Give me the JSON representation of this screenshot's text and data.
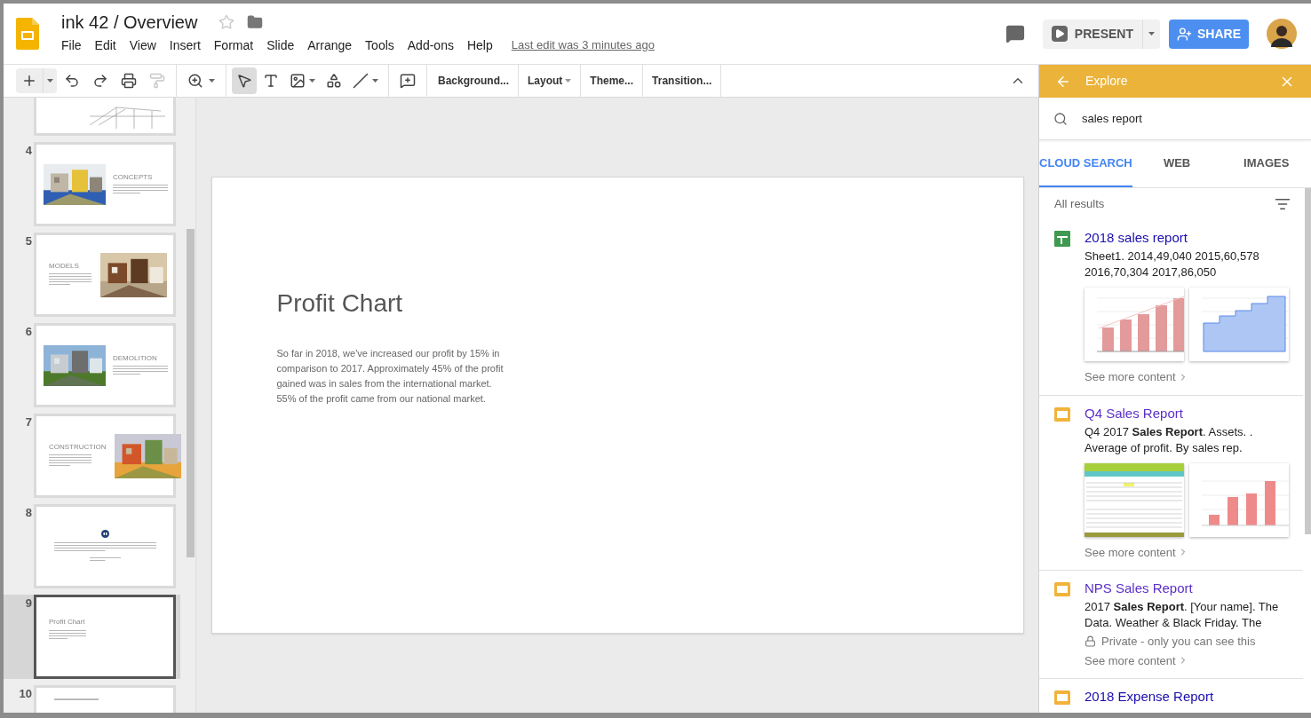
{
  "document": {
    "title": "ink 42 / Overview",
    "starred": false
  },
  "menu": [
    "File",
    "Edit",
    "View",
    "Insert",
    "Format",
    "Slide",
    "Arrange",
    "Tools",
    "Add-ons",
    "Help"
  ],
  "last_edit": "Last edit was 3 minutes ago",
  "present": "PRESENT",
  "share": "SHARE",
  "toolbar": {
    "paint_format_disabled": true,
    "tools": [
      {
        "selected": true
      },
      {
        "selected": false
      },
      {
        "selected": false
      },
      {
        "selected": false
      },
      {
        "selected": false
      }
    ],
    "text_buttons": [
      {
        "label": "Background...",
        "dropdown": false
      },
      {
        "label": "Layout",
        "dropdown": true
      },
      {
        "label": "Theme...",
        "dropdown": false
      },
      {
        "label": "Transition...",
        "dropdown": false
      }
    ]
  },
  "slides": [
    {
      "kind": "sketch",
      "selected": false
    },
    {
      "number": "4",
      "kind": "image-left",
      "title": "CONCEPTS",
      "selected": false
    },
    {
      "number": "5",
      "kind": "image-right",
      "title": "MODELS",
      "selected": false
    },
    {
      "number": "6",
      "kind": "image-left",
      "title": "DEMOLITION",
      "selected": false
    },
    {
      "number": "7",
      "kind": "image-right",
      "title": "CONSTRUCTION",
      "selected": false
    },
    {
      "number": "8",
      "kind": "quote",
      "selected": false
    },
    {
      "number": "9",
      "kind": "text",
      "title": "Profit Chart",
      "selected": true
    },
    {
      "number": "10",
      "kind": "partial",
      "selected": false
    }
  ],
  "current_slide": {
    "title": "Profit Chart",
    "body": "So far in 2018, we've increased our profit by 15% in comparison to 2017. Approximately 45% of the profit gained was in sales from the international market. 55% of the profit came from our national market."
  },
  "explore": {
    "title": "Explore",
    "search": "sales report",
    "tabs": [
      {
        "label": "CLOUD SEARCH",
        "selected": true
      },
      {
        "label": "WEB",
        "selected": false
      },
      {
        "label": "IMAGES",
        "selected": false
      }
    ],
    "filter_label": "All results",
    "results": [
      {
        "kind": "sheet",
        "title": "2018 sales report",
        "visited": false,
        "snippet": "Sheet1. 2014,49,040 2015,60,578 2016,70,304 2017,86,050",
        "previews": [
          {
            "kind": "bar"
          },
          {
            "kind": "area"
          }
        ],
        "more": "See more content"
      },
      {
        "kind": "slides",
        "title": "Q4 Sales Report",
        "visited": true,
        "snippet": "Q4 2017 **Sales Report**. Assets. . Average of profit. By sales rep.",
        "previews": [
          {
            "kind": "table"
          },
          {
            "kind": "columns"
          }
        ],
        "more": "See more content"
      },
      {
        "kind": "slides",
        "title": "NPS Sales Report",
        "visited": true,
        "snippet": "2017 **Sales Report**. [Your name]. The Data. Weather & Black Friday. The",
        "note": "Private - only you can see this",
        "more": "See more content"
      },
      {
        "kind": "slides",
        "title": "2018 Expense Report",
        "visited": false
      }
    ]
  }
}
